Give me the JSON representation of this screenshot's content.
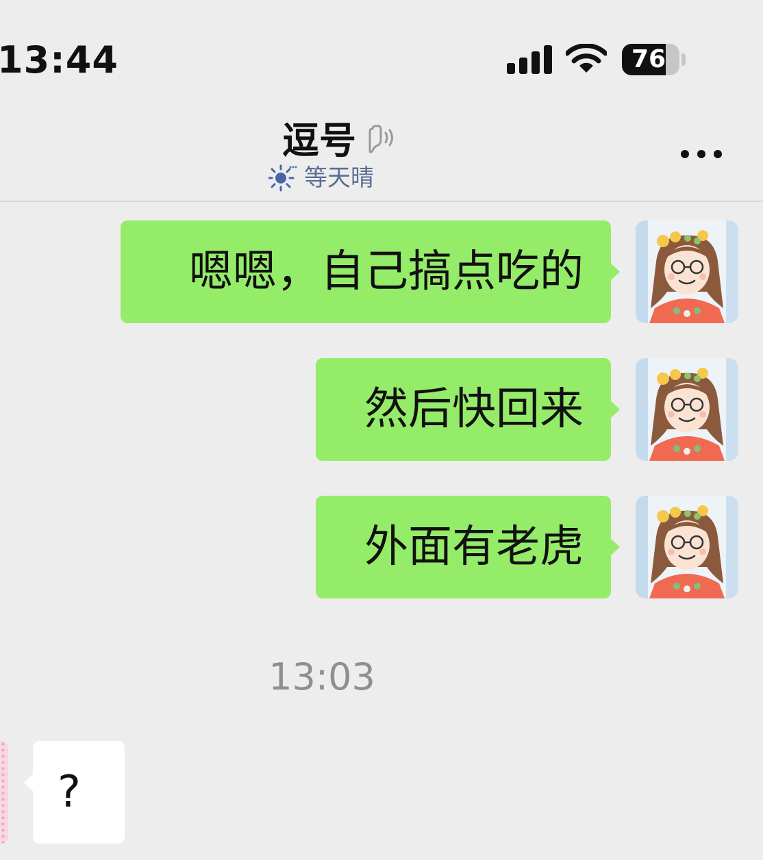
{
  "status_bar": {
    "time": "13:44",
    "battery_level": "76",
    "battery_fraction": 0.76,
    "icons": [
      "cellular-signal-icon",
      "wifi-icon",
      "battery-icon"
    ]
  },
  "header": {
    "contact_name": "逗号",
    "contact_status": "等天晴",
    "icons": [
      "voice-icon",
      "sun-icon",
      "more-icon"
    ]
  },
  "messages": [
    {
      "direction": "outgoing",
      "text": "嗯嗯，自己搞点吃的"
    },
    {
      "direction": "outgoing",
      "text": "然后快回来"
    },
    {
      "direction": "outgoing",
      "text": "外面有老虎"
    }
  ],
  "time_divider": "13:03",
  "incoming_message": {
    "direction": "incoming",
    "text": "?"
  },
  "colors": {
    "background": "#ededed",
    "outgoing_bubble": "#95ec69",
    "incoming_bubble": "#ffffff",
    "status_text": "#5a6e94",
    "time_divider_text": "#8f8f8f"
  }
}
